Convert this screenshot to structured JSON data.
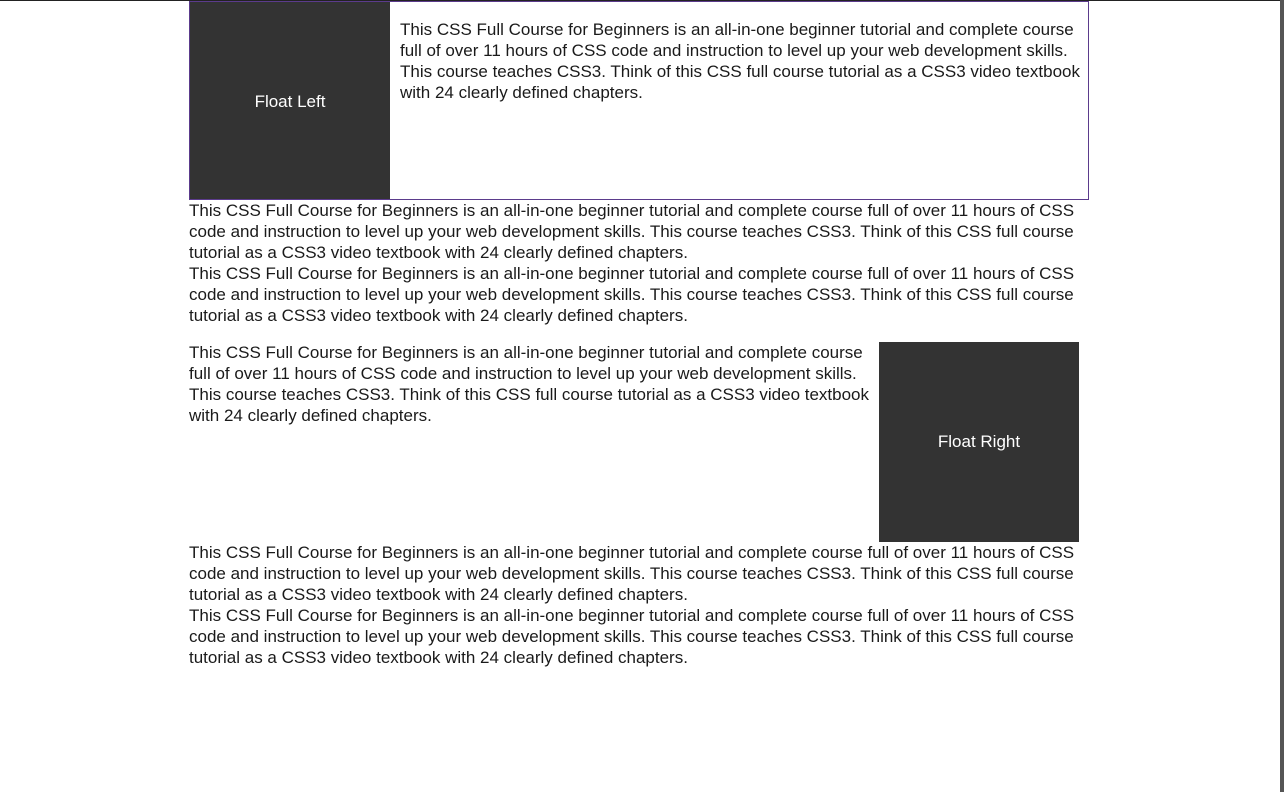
{
  "float_left_box": {
    "label": "Float Left"
  },
  "float_right_box": {
    "label": "Float Right"
  },
  "paragraphs": {
    "text": "This CSS Full Course for Beginners is an all-in-one beginner tutorial and complete course full of over 11 hours of CSS code and instruction to level up your web development skills. This course teaches CSS3. Think of this CSS full course tutorial as a CSS3 video textbook with 24 clearly defined chapters.",
    "float_left_text": "This CSS Full Course for Beginners is an all-in-one beginner tutorial and complete course full of over 11 hours of CSS code and instruction to level up your web development skills. This course teaches CSS3. Think of this CSS full course tutorial as a CSS3 video textbook with 24 clearly defined chapters.",
    "p1": "This CSS Full Course for Beginners is an all-in-one beginner tutorial and complete course full of over 11 hours of CSS code and instruction to level up your web development skills. This course teaches CSS3. Think of this CSS full course tutorial as a CSS3 video textbook with 24 clearly defined chapters.",
    "p2": "This CSS Full Course for Beginners is an all-in-one beginner tutorial and complete course full of over 11 hours of CSS code and instruction to level up your web development skills. This course teaches CSS3. Think of this CSS full course tutorial as a CSS3 video textbook with 24 clearly defined chapters.",
    "float_right_text": "This CSS Full Course for Beginners is an all-in-one beginner tutorial and complete course full of over 11 hours of CSS code and instruction to level up your web development skills. This course teaches CSS3. Think of this CSS full course tutorial as a CSS3 video textbook with 24 clearly defined chapters.",
    "p4": "This CSS Full Course for Beginners is an all-in-one beginner tutorial and complete course full of over 11 hours of CSS code and instruction to level up your web development skills. This course teaches CSS3. Think of this CSS full course tutorial as a CSS3 video textbook with 24 clearly defined chapters.",
    "p5": "This CSS Full Course for Beginners is an all-in-one beginner tutorial and complete course full of over 11 hours of CSS code and instruction to level up your web development skills. This course teaches CSS3. Think of this CSS full course tutorial as a CSS3 video textbook with 24 clearly defined chapters."
  },
  "colors": {
    "box_background": "#333333",
    "box_text": "#ffffff",
    "section_border": "#5b3b8c"
  }
}
